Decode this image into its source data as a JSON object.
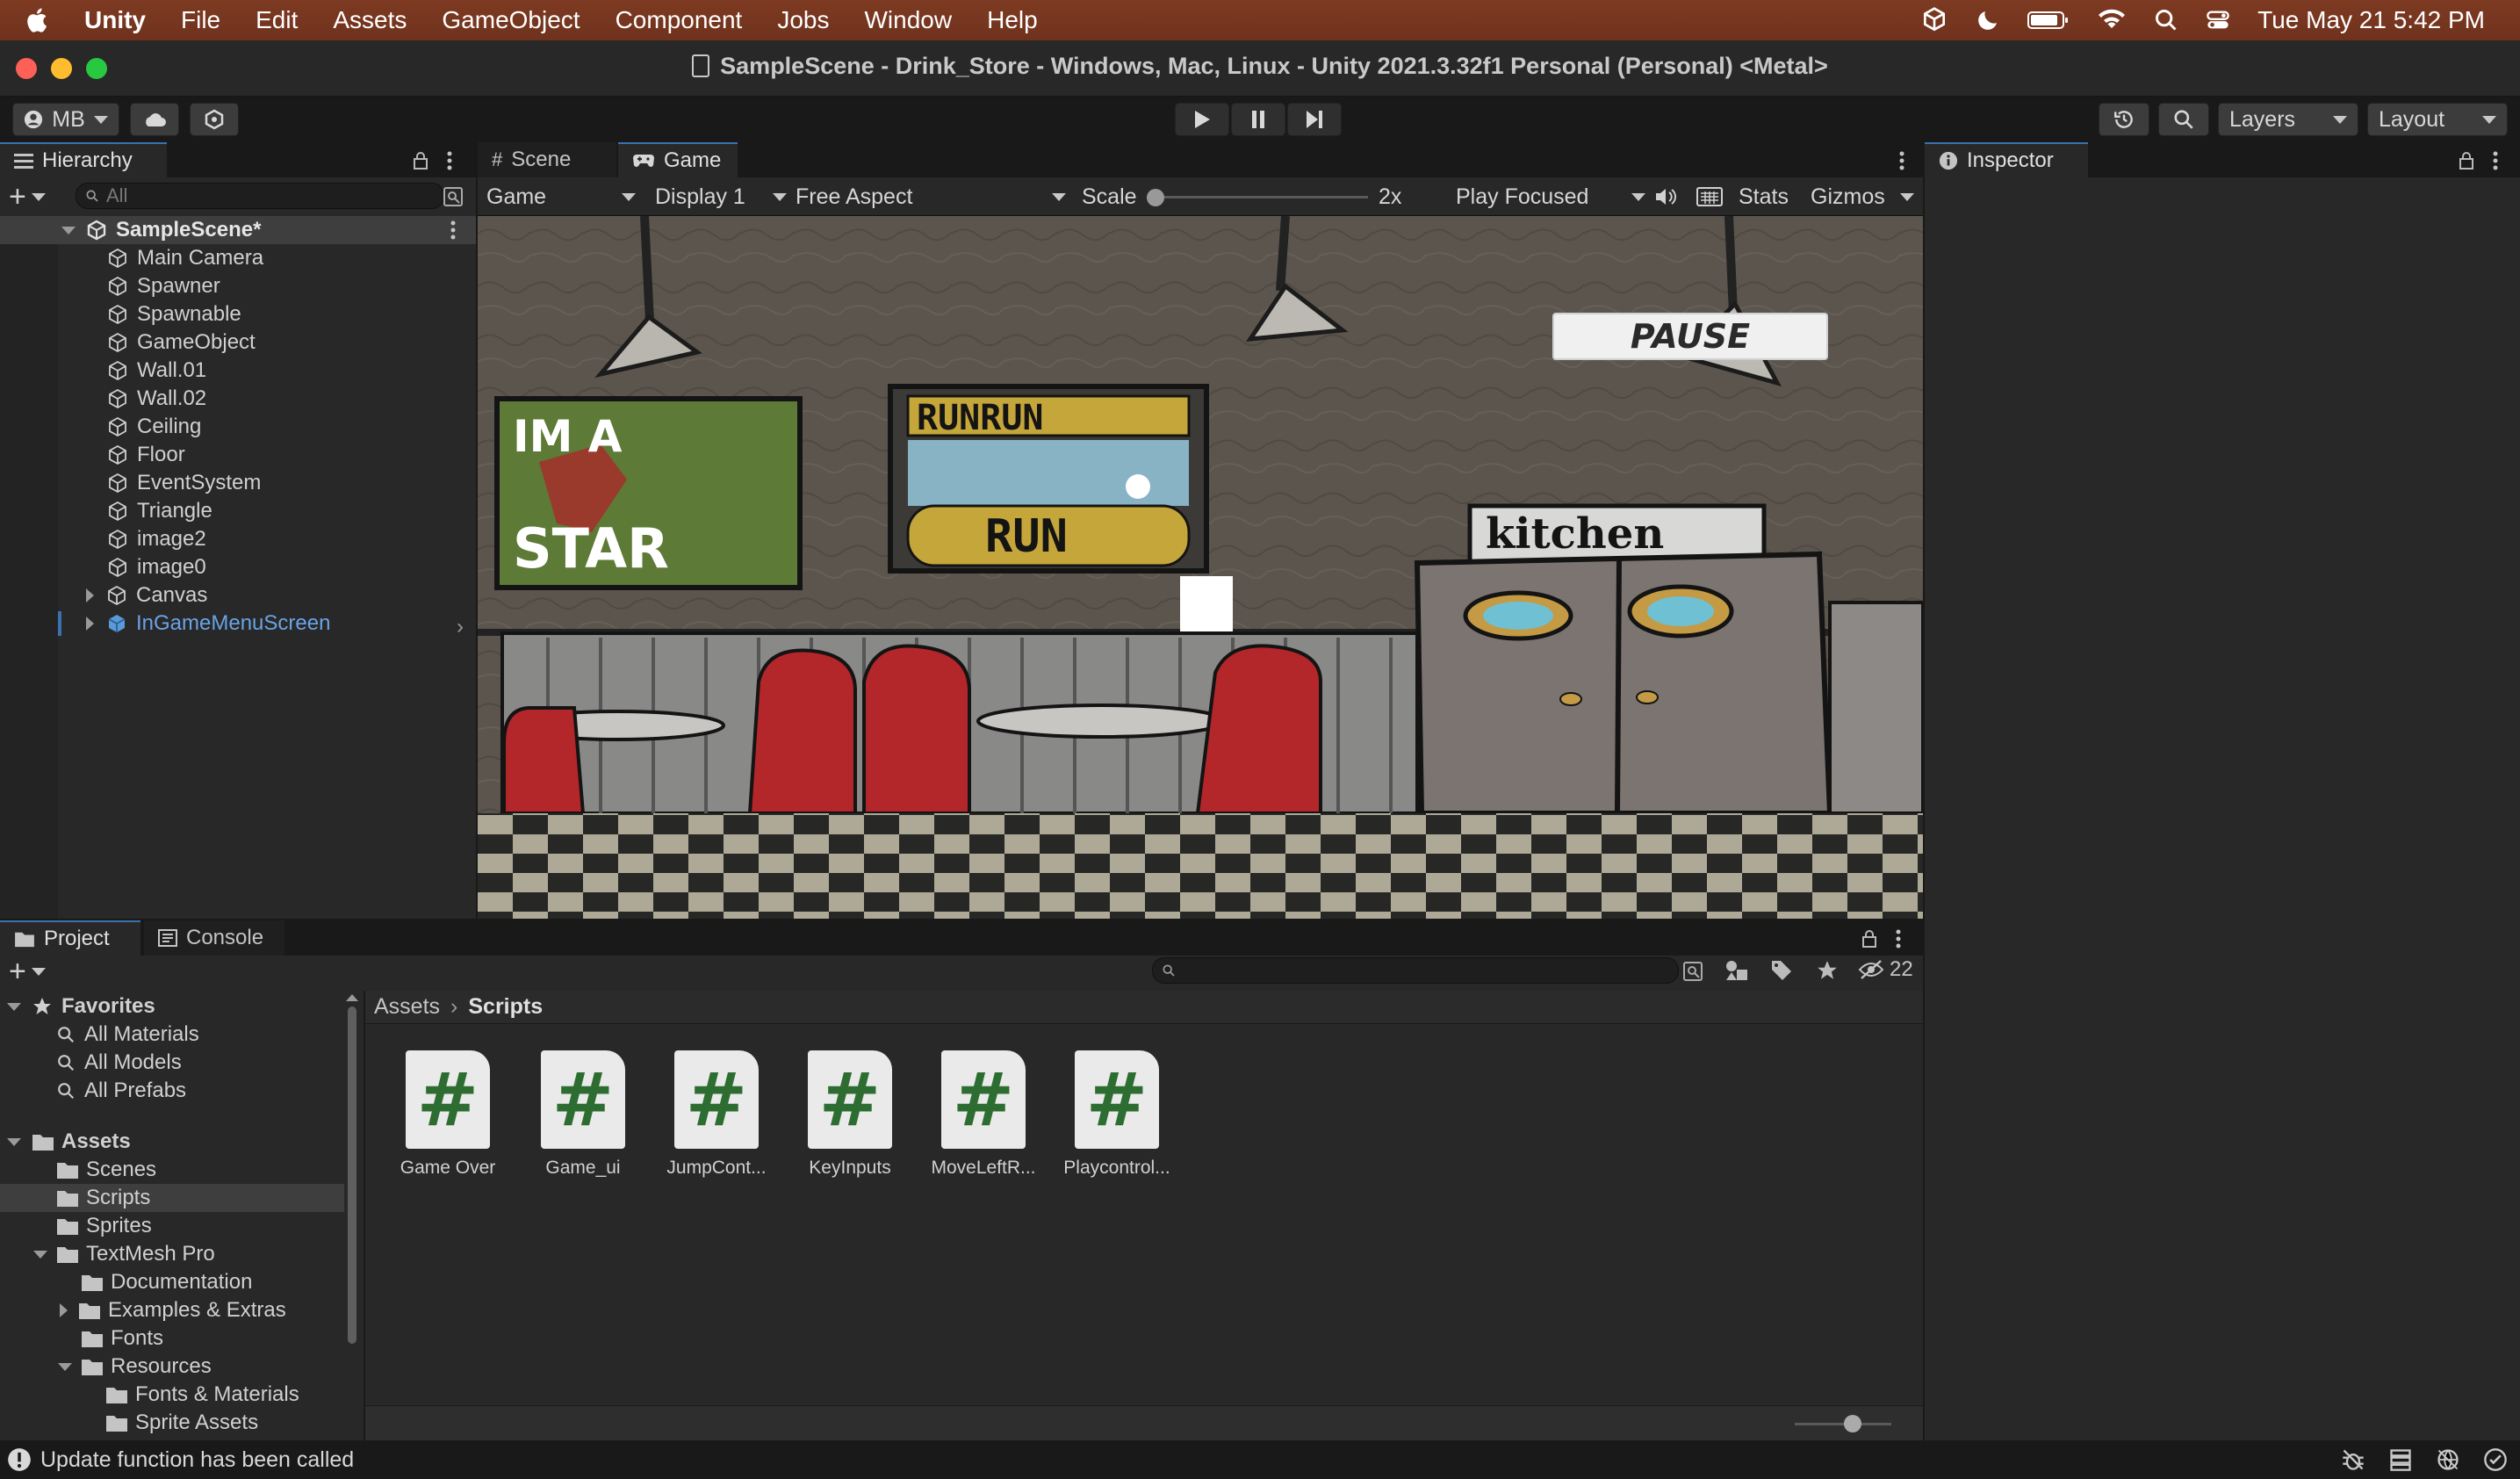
{
  "menubar": {
    "app": "Unity",
    "items": [
      "File",
      "Edit",
      "Assets",
      "GameObject",
      "Component",
      "Jobs",
      "Window",
      "Help"
    ],
    "clock": "Tue May 21  5:42 PM"
  },
  "window": {
    "title": "SampleScene - Drink_Store - Windows, Mac, Linux - Unity 2021.3.32f1 Personal (Personal) <Metal>"
  },
  "toolbar": {
    "account": "MB",
    "layers": "Layers",
    "layout": "Layout"
  },
  "hierarchy": {
    "tab": "Hierarchy",
    "search_placeholder": "All",
    "scene": "SampleScene*",
    "items": [
      "Main Camera",
      "Spawner",
      "Spawnable",
      "GameObject",
      "Wall.01",
      "Wall.02",
      "Ceiling",
      "Floor",
      "EventSystem",
      "Triangle",
      "image2",
      "image0",
      "Canvas",
      "InGameMenuScreen"
    ]
  },
  "game_view": {
    "tabs": [
      "Scene",
      "Game"
    ],
    "mode": "Game",
    "display": "Display 1",
    "aspect": "Free Aspect",
    "scale_label": "Scale",
    "scale_value": "2x",
    "play_mode": "Play Focused",
    "stats": "Stats",
    "gizmos": "Gizmos",
    "pause_button": "PAUSE",
    "poster1_top": "IM A",
    "poster1_bottom": "STAR",
    "poster2_top": "RUNRUN",
    "poster2_bottom": "RUN",
    "kitchen_sign": "kitchen"
  },
  "inspector": {
    "tab": "Inspector"
  },
  "project": {
    "tabs": [
      "Project",
      "Console"
    ],
    "hidden_count": "22",
    "breadcrumb_root": "Assets",
    "breadcrumb_current": "Scripts",
    "favorites_label": "Favorites",
    "favorites": [
      "All Materials",
      "All Models",
      "All Prefabs"
    ],
    "assets_label": "Assets",
    "folders": [
      "Scenes",
      "Scripts",
      "Sprites",
      "TextMesh Pro",
      "Documentation",
      "Examples & Extras",
      "Fonts",
      "Resources",
      "Fonts & Materials",
      "Sprite Assets"
    ],
    "scripts": [
      "Game Over",
      "Game_ui",
      "JumpCont...",
      "KeyInputs",
      "MoveLeftR...",
      "Playcontrol..."
    ]
  },
  "status": {
    "message": "Update function has been called"
  }
}
